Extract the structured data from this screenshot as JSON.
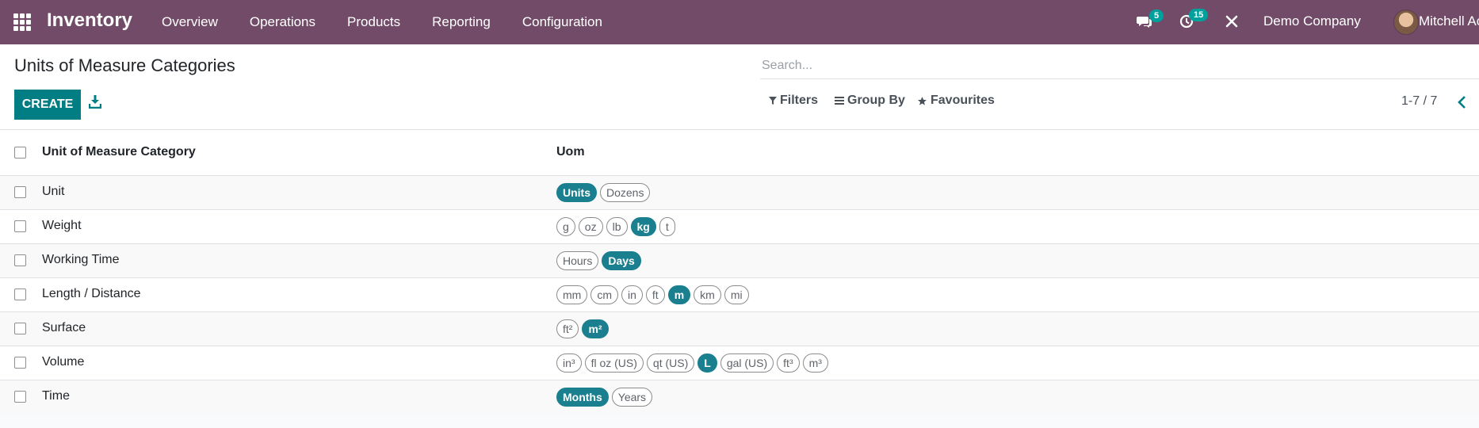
{
  "navbar": {
    "app_title": "Inventory",
    "menu": [
      "Overview",
      "Operations",
      "Products",
      "Reporting",
      "Configuration"
    ],
    "messages_count": "5",
    "activities_count": "15",
    "company": "Demo Company",
    "user": "Mitchell Ac"
  },
  "control_panel": {
    "title": "Units of Measure Categories",
    "search_placeholder": "Search...",
    "create_label": "CREATE",
    "filters_label": "Filters",
    "group_by_label": "Group By",
    "favourites_label": "Favourites",
    "pager": "1-7 / 7"
  },
  "table": {
    "columns": [
      "Unit of Measure Category",
      "Uom"
    ],
    "rows": [
      {
        "name": "Unit",
        "uoms": [
          {
            "label": "Units",
            "active": true
          },
          {
            "label": "Dozens",
            "active": false
          }
        ]
      },
      {
        "name": "Weight",
        "uoms": [
          {
            "label": "g",
            "active": false
          },
          {
            "label": "oz",
            "active": false
          },
          {
            "label": "lb",
            "active": false
          },
          {
            "label": "kg",
            "active": true
          },
          {
            "label": "t",
            "active": false
          }
        ]
      },
      {
        "name": "Working Time",
        "uoms": [
          {
            "label": "Hours",
            "active": false
          },
          {
            "label": "Days",
            "active": true
          }
        ]
      },
      {
        "name": "Length / Distance",
        "uoms": [
          {
            "label": "mm",
            "active": false
          },
          {
            "label": "cm",
            "active": false
          },
          {
            "label": "in",
            "active": false
          },
          {
            "label": "ft",
            "active": false
          },
          {
            "label": "m",
            "active": true
          },
          {
            "label": "km",
            "active": false
          },
          {
            "label": "mi",
            "active": false
          }
        ]
      },
      {
        "name": "Surface",
        "uoms": [
          {
            "label": "ft²",
            "active": false
          },
          {
            "label": "m²",
            "active": true
          }
        ]
      },
      {
        "name": "Volume",
        "uoms": [
          {
            "label": "in³",
            "active": false
          },
          {
            "label": "fl oz (US)",
            "active": false
          },
          {
            "label": "qt (US)",
            "active": false
          },
          {
            "label": "L",
            "active": true
          },
          {
            "label": "gal (US)",
            "active": false
          },
          {
            "label": "ft³",
            "active": false
          },
          {
            "label": "m³",
            "active": false
          }
        ]
      },
      {
        "name": "Time",
        "uoms": [
          {
            "label": "Months",
            "active": true
          },
          {
            "label": "Years",
            "active": false
          }
        ]
      }
    ]
  },
  "colors": {
    "navbar": "#714b67",
    "primary": "#017e84",
    "active_tag": "#1a7f8e",
    "badge": "#00a09d"
  }
}
